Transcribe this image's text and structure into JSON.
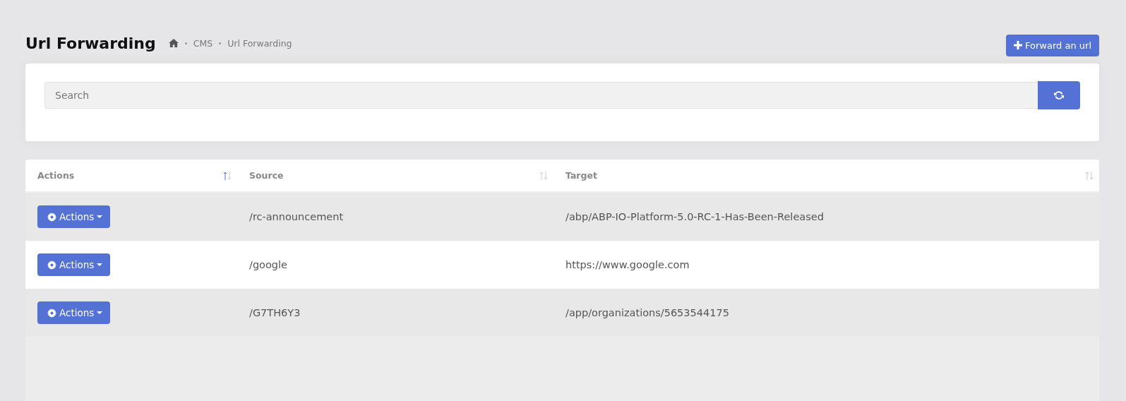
{
  "page": {
    "title": "Url Forwarding"
  },
  "breadcrumb": [
    {
      "kind": "home"
    },
    {
      "kind": "text",
      "label": "CMS"
    },
    {
      "kind": "text",
      "label": "Url Forwarding"
    }
  ],
  "forward_button": {
    "label": "Forward an url"
  },
  "search": {
    "placeholder": "Search"
  },
  "table": {
    "columns": [
      {
        "label": "Actions",
        "sorted": true
      },
      {
        "label": "Source",
        "sorted": false
      },
      {
        "label": "Target",
        "sorted": false
      }
    ],
    "rows": [
      {
        "action": "Actions",
        "source": "/rc-announcement",
        "target": "/abp/ABP-IO-Platform-5.0-RC-1-Has-Been-Released"
      },
      {
        "action": "Actions",
        "source": "/google",
        "target": "https://www.google.com"
      },
      {
        "action": "Actions",
        "source": "/G7TH6Y3",
        "target": "/app/organizations/5653544175"
      }
    ]
  }
}
